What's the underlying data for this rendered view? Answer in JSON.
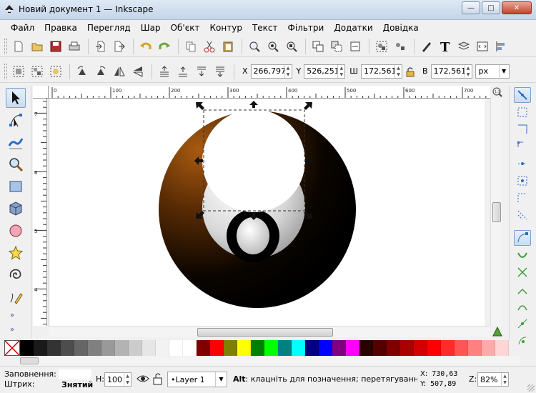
{
  "window": {
    "title": "Новий документ 1 — Inkscape",
    "buttons": {
      "minimize": "—",
      "maximize": "□",
      "close": "✕"
    }
  },
  "menu": [
    "Файл",
    "Правка",
    "Перегляд",
    "Шар",
    "Об'єкт",
    "Контур",
    "Текст",
    "Фільтри",
    "Додатки",
    "Довідка"
  ],
  "selection_toolbar": {
    "x_label": "X",
    "x_value": "266,797",
    "y_label": "Y",
    "y_value": "526,251",
    "w_label": "Ш",
    "w_value": "172,561",
    "h_label": "В",
    "h_value": "172,561",
    "unit": "px"
  },
  "rulers": {
    "horizontal_ticks": [
      "0",
      "100",
      "200",
      "300",
      "400",
      "500",
      "600",
      "700"
    ],
    "vertical_ticks": [
      "7",
      "6",
      "5",
      "4"
    ]
  },
  "palette": [
    "#000000",
    "#1a1a1a",
    "#333333",
    "#4d4d4d",
    "#666666",
    "#808080",
    "#999999",
    "#b3b3b3",
    "#cccccc",
    "#e6e6e6",
    "#f2f2f2",
    "#ffffff",
    "#ffffff",
    "#800000",
    "#ff0000",
    "#808000",
    "#ffff00",
    "#008000",
    "#00ff00",
    "#008080",
    "#00ffff",
    "#000080",
    "#0000ff",
    "#800080",
    "#ff00ff",
    "#2b0000",
    "#550000",
    "#800000",
    "#aa0000",
    "#d40000",
    "#ff0000",
    "#ff2a2a",
    "#ff5555",
    "#ff8080",
    "#ffaaaa",
    "#ffd5d5"
  ],
  "status": {
    "fill_label": "Заповнення:",
    "stroke_label": "Штрих:",
    "stroke_value": "Знятий",
    "h_label": "Н:",
    "h_value": "100",
    "layer": "•Layer 1",
    "message_key": "Alt",
    "message": ": клацніть для позначення; перетягування д...",
    "x_label": "X:",
    "x_value": "730,63",
    "y_label": "Y:",
    "y_value": "507,89",
    "zoom_label": "Z:",
    "zoom_value": "82%"
  },
  "more_label": "»"
}
